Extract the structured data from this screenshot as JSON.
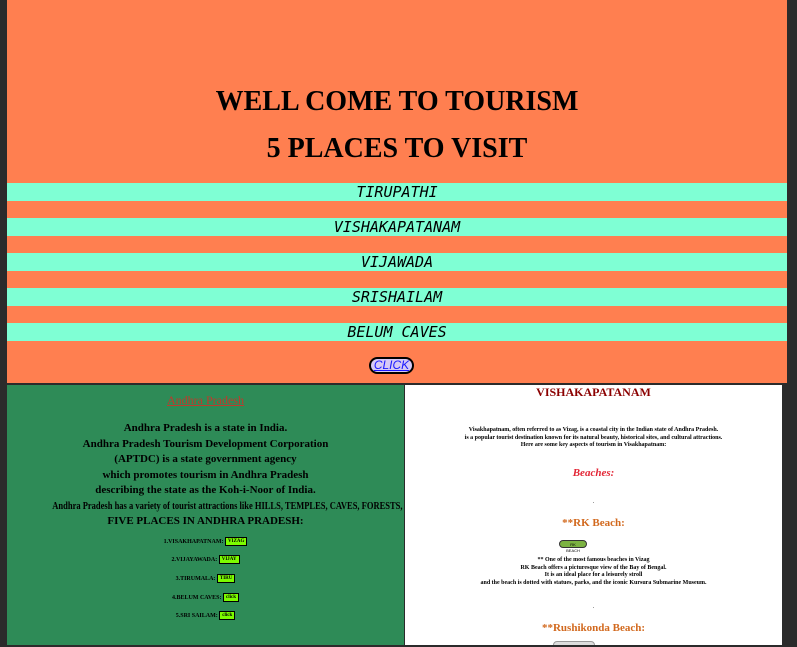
{
  "header": {
    "title": "WELL COME TO TOURISM",
    "subtitle": "5 PLACES TO VISIT"
  },
  "places": [
    "TIRUPATHI",
    "VISHAKAPATANAM",
    "VIJAWADA",
    "SRISHAILAM",
    "BELUM CAVES"
  ],
  "click_label": "CLICK",
  "left_panel": {
    "heading": "Andhra Pradesh",
    "lines": [
      "Andhra Pradesh is a state in India.",
      "Andhra Pradesh Tourism Development Corporation",
      "(APTDC) is a state government agency",
      "which promotes tourism in Andhra Pradesh",
      "describing the state as the Koh-i-Noor of India.",
      "Andhra Pradesh has a variety of tourist attractions like HILLS, TEMPLES, CAVES, FORESTS, BEACHES.",
      "FIVE PLACES IN ANDHRA PRADESH:"
    ],
    "list": [
      {
        "label": "1.VISAKHAPATNAM:",
        "button": "VIZAG"
      },
      {
        "label": "2.VIJAYAWADA:",
        "button": "VIJAY"
      },
      {
        "label": "3.TIRUMALA:",
        "button": "TIRU"
      },
      {
        "label": "4.BELUM CAVES:",
        "button": "click"
      },
      {
        "label": "5.SRI SAILAM:",
        "button": "click"
      }
    ]
  },
  "right_panel": {
    "title": "VISHAKAPATANAM",
    "intro": [
      "Visakhapatnam, often referred to as Vizag, is a coastal city in the Indian state of Andhra Pradesh.",
      "is a popular tourist destination known for its natural beauty, historical sites, and cultural attractions.",
      "Here are some key aspects of tourism in Visakhapatnam:"
    ],
    "beaches_heading": "Beaches:",
    "dot": ".",
    "rk_heading": "**RK Beach:",
    "rk_button": "RK BEACH",
    "rk_desc": [
      "** One of the most famous beaches in Vizag",
      "RK Beach offers a picturesque view of the Bay of Bengal.",
      "It is an ideal place for a leisurely stroll",
      "and the beach is dotted with statues, parks, and the iconic Kursura Submarine Museum."
    ],
    "rushikonda_heading": "**Rushikonda Beach:"
  },
  "colors": {
    "top_bg": "#ff7f50",
    "bar_bg": "#7fffd4",
    "left_bg": "#2e8b57",
    "right_bg": "#ffffff",
    "mini_button": "#7cfc00"
  }
}
